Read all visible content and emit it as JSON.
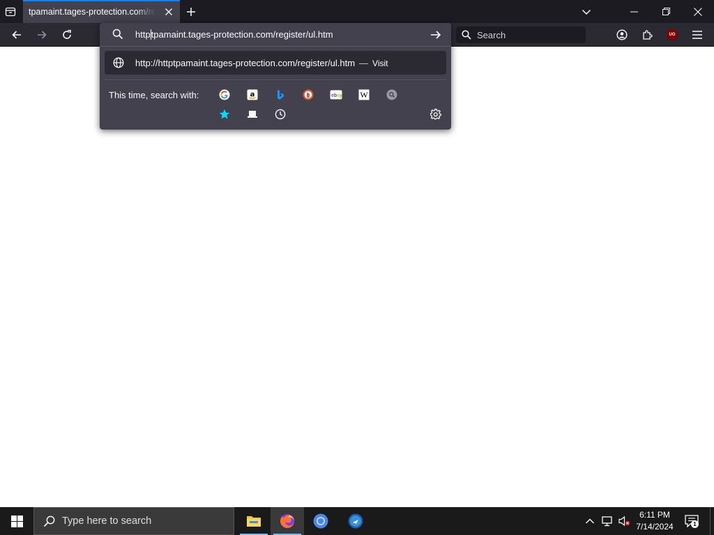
{
  "browser": {
    "tab": {
      "title": "tpamaint.tages-protection.com/register/ul.htm"
    },
    "search_placeholder": "Search",
    "urlbar": {
      "typed_before_caret": "http",
      "typed_after_caret": "tpamaint.tages-protection.com/register/ul.htm"
    },
    "result": {
      "url": "http://httptpamaint.tages-protection.com/register/ul.htm",
      "dash": "—",
      "action": "Visit"
    },
    "oneoff": {
      "label": "This time, search with:",
      "engines": [
        "Google",
        "Amazon.com",
        "Bing",
        "DuckDuckGo",
        "eBay",
        "Wikipedia (en)",
        "Search engine",
        "Bookmarks",
        "Tabs",
        "History"
      ]
    },
    "addon_badge": "UO"
  },
  "taskbar": {
    "search_placeholder": "Type here to search",
    "apps": [
      "File Explorer",
      "Firefox",
      "Chromium",
      "Media app"
    ],
    "clock": {
      "time": "6:11 PM",
      "date": "7/14/2024"
    },
    "notification_count": "1"
  },
  "colors": {
    "accent": "#0a84ff",
    "tab_bg": "#42414d",
    "toolbar_bg": "#2b2a33",
    "tabstrip_bg": "#1c1b22"
  }
}
